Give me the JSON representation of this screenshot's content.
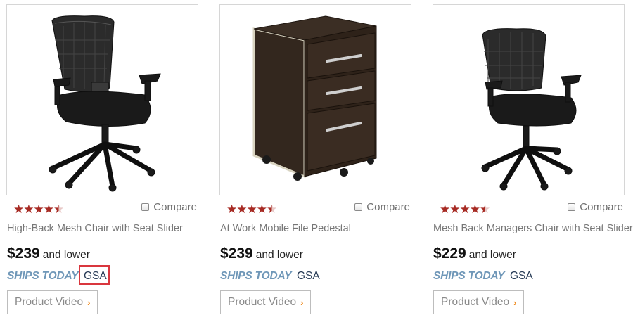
{
  "products": [
    {
      "name": "High-Back Mesh Chair with Seat Slider",
      "price": "$239",
      "price_suffix": "and lower",
      "rating": 4.5,
      "compare_label": "Compare",
      "ships_label": "SHIPS TODAY",
      "gsa_label": "GSA",
      "gsa_highlighted": true,
      "video_label": "Product Video",
      "image_icon": "chair-icon"
    },
    {
      "name": "At Work Mobile File Pedestal",
      "price": "$239",
      "price_suffix": "and lower",
      "rating": 4.5,
      "compare_label": "Compare",
      "ships_label": "SHIPS TODAY",
      "gsa_label": "GSA",
      "gsa_highlighted": false,
      "video_label": "Product Video",
      "image_icon": "file-pedestal-icon"
    },
    {
      "name": "Mesh Back Managers Chair with Seat Slider",
      "price": "$229",
      "price_suffix": "and lower",
      "rating": 4.5,
      "compare_label": "Compare",
      "ships_label": "SHIPS TODAY",
      "gsa_label": "GSA",
      "gsa_highlighted": false,
      "video_label": "Product Video",
      "image_icon": "chair-icon"
    }
  ],
  "colors": {
    "star": "#a72b24",
    "ships_today": "#6f97b8",
    "gsa_text": "#273b56",
    "highlight_border": "#d9363e",
    "chevron": "#f08a1c"
  },
  "icons": {
    "star": "star-icon",
    "half_star": "half-star-icon",
    "chevron": "chevron-right-icon",
    "checkbox": "checkbox-icon"
  }
}
